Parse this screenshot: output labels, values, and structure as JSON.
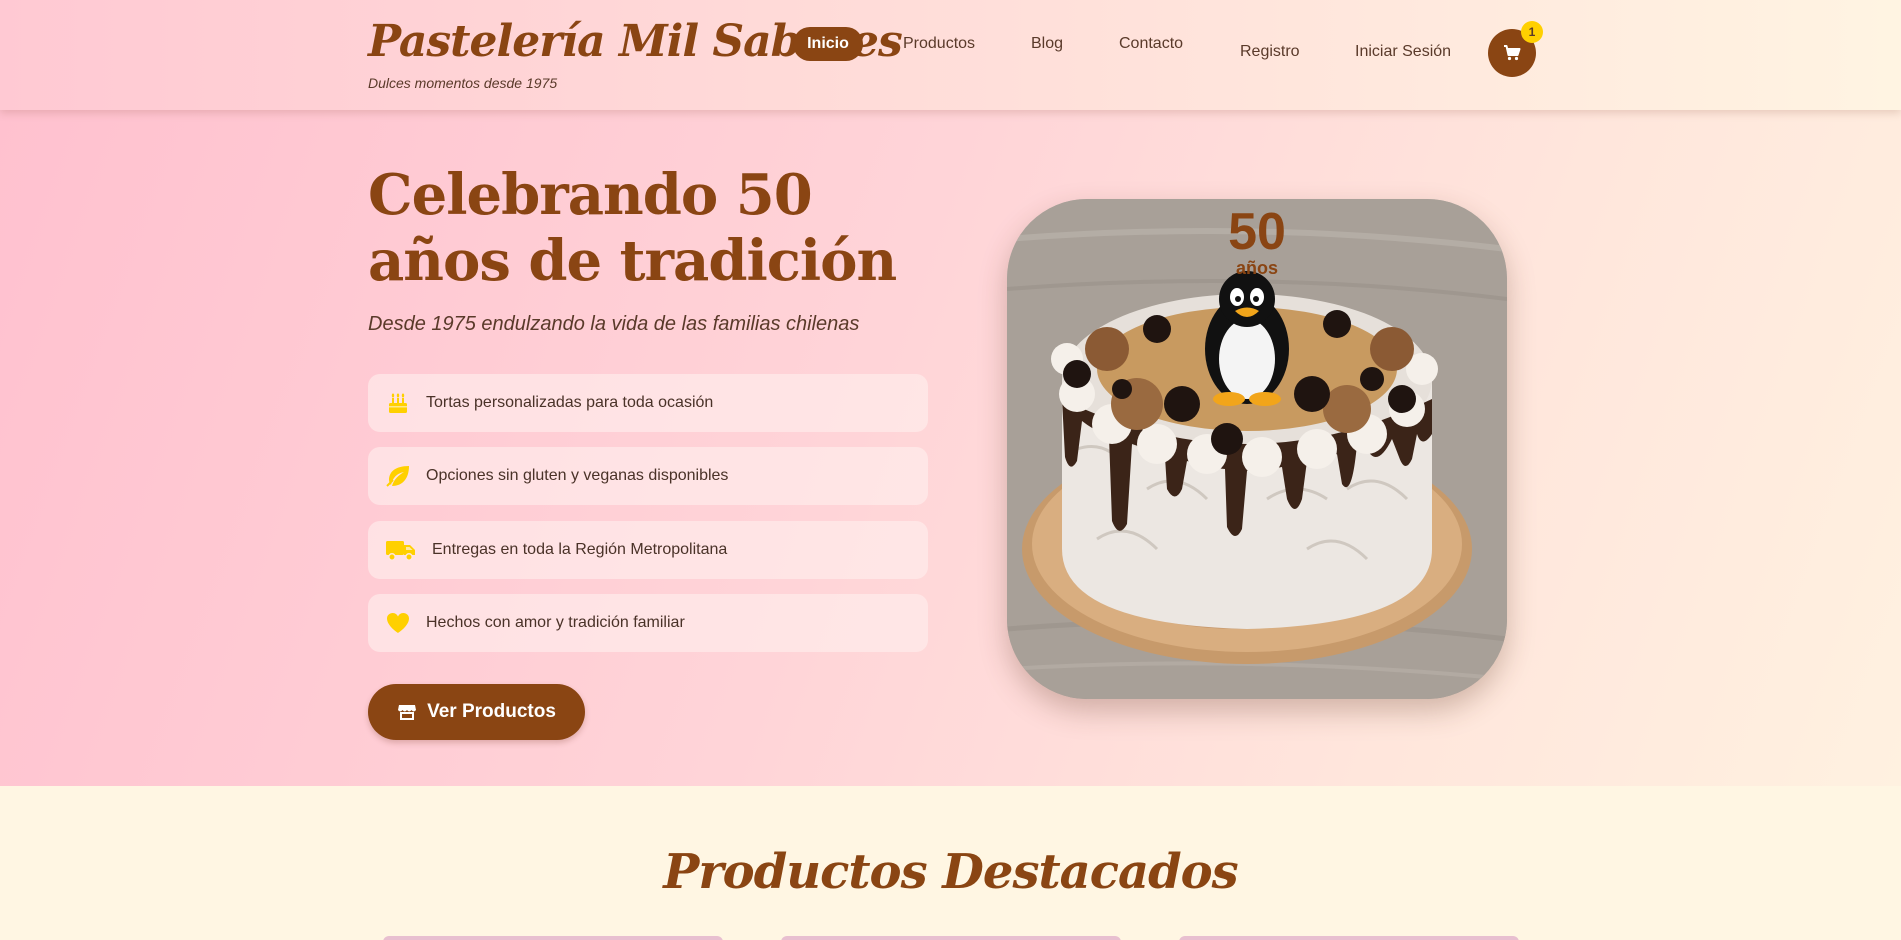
{
  "header": {
    "logo": "Pastelería Mil Sabores",
    "tagline": "Dulces momentos desde 1975",
    "nav": [
      {
        "label": "Inicio",
        "active": true
      },
      {
        "label": "Productos"
      },
      {
        "label": "Blog"
      },
      {
        "label": "Contacto"
      },
      {
        "label": "Registro"
      },
      {
        "label": "Iniciar Sesión"
      }
    ],
    "cart": {
      "icon": "cart-icon",
      "count": "1"
    }
  },
  "hero": {
    "title": "Celebrando 50 años de tradición",
    "subtitle": "Desde 1975 endulzando la vida de las familias chilenas",
    "features": [
      {
        "icon": "birthday-cake-icon",
        "text": "Tortas personalizadas para toda ocasión"
      },
      {
        "icon": "leaf-icon",
        "text": "Opciones sin gluten y veganas disponibles"
      },
      {
        "icon": "truck-icon",
        "text": "Entregas en toda la Región Metropolitana"
      },
      {
        "icon": "heart-icon",
        "text": "Hechos con amor y tradición familiar"
      }
    ],
    "cta": {
      "icon": "store-icon",
      "label": "Ver Productos"
    },
    "image_badge": {
      "number": "50",
      "label": "años"
    }
  },
  "featured": {
    "title": "Productos Destacados"
  },
  "colors": {
    "brand_brown": "#8a4513",
    "accent_yellow": "#ffd000",
    "hero_pink": "#ffc1cf",
    "cream": "#fff6e3"
  }
}
